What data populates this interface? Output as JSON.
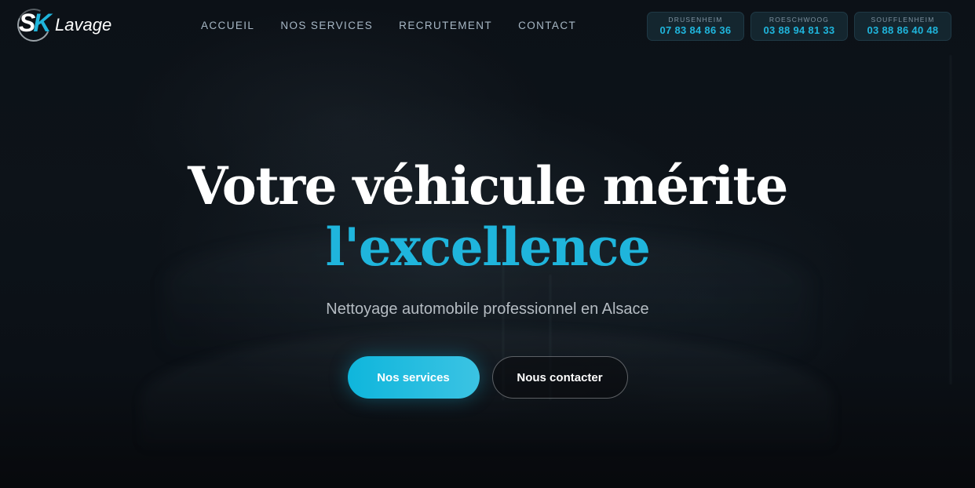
{
  "brand": {
    "logo_letters_s": "S",
    "logo_letters_k": "K",
    "name": "Lavage"
  },
  "nav": {
    "items": [
      {
        "label": "ACCUEIL"
      },
      {
        "label": "NOS SERVICES"
      },
      {
        "label": "RECRUTEMENT"
      },
      {
        "label": "CONTACT"
      }
    ]
  },
  "phones": [
    {
      "city": "DRUSENHEIM",
      "number": "07 83 84 86 36"
    },
    {
      "city": "ROESCHWOOG",
      "number": "03 88 94 81 33"
    },
    {
      "city": "SOUFFLENHEIM",
      "number": "03 88 86 40 48"
    }
  ],
  "hero": {
    "title_line1": "Votre véhicule mérite",
    "title_line2": "l'excellence",
    "subtitle": "Nettoyage automobile professionnel en Alsace",
    "primary_button": "Nos services",
    "secondary_button": "Nous contacter"
  },
  "colors": {
    "accent": "#1fb5dc",
    "background": "#0a0e13"
  }
}
